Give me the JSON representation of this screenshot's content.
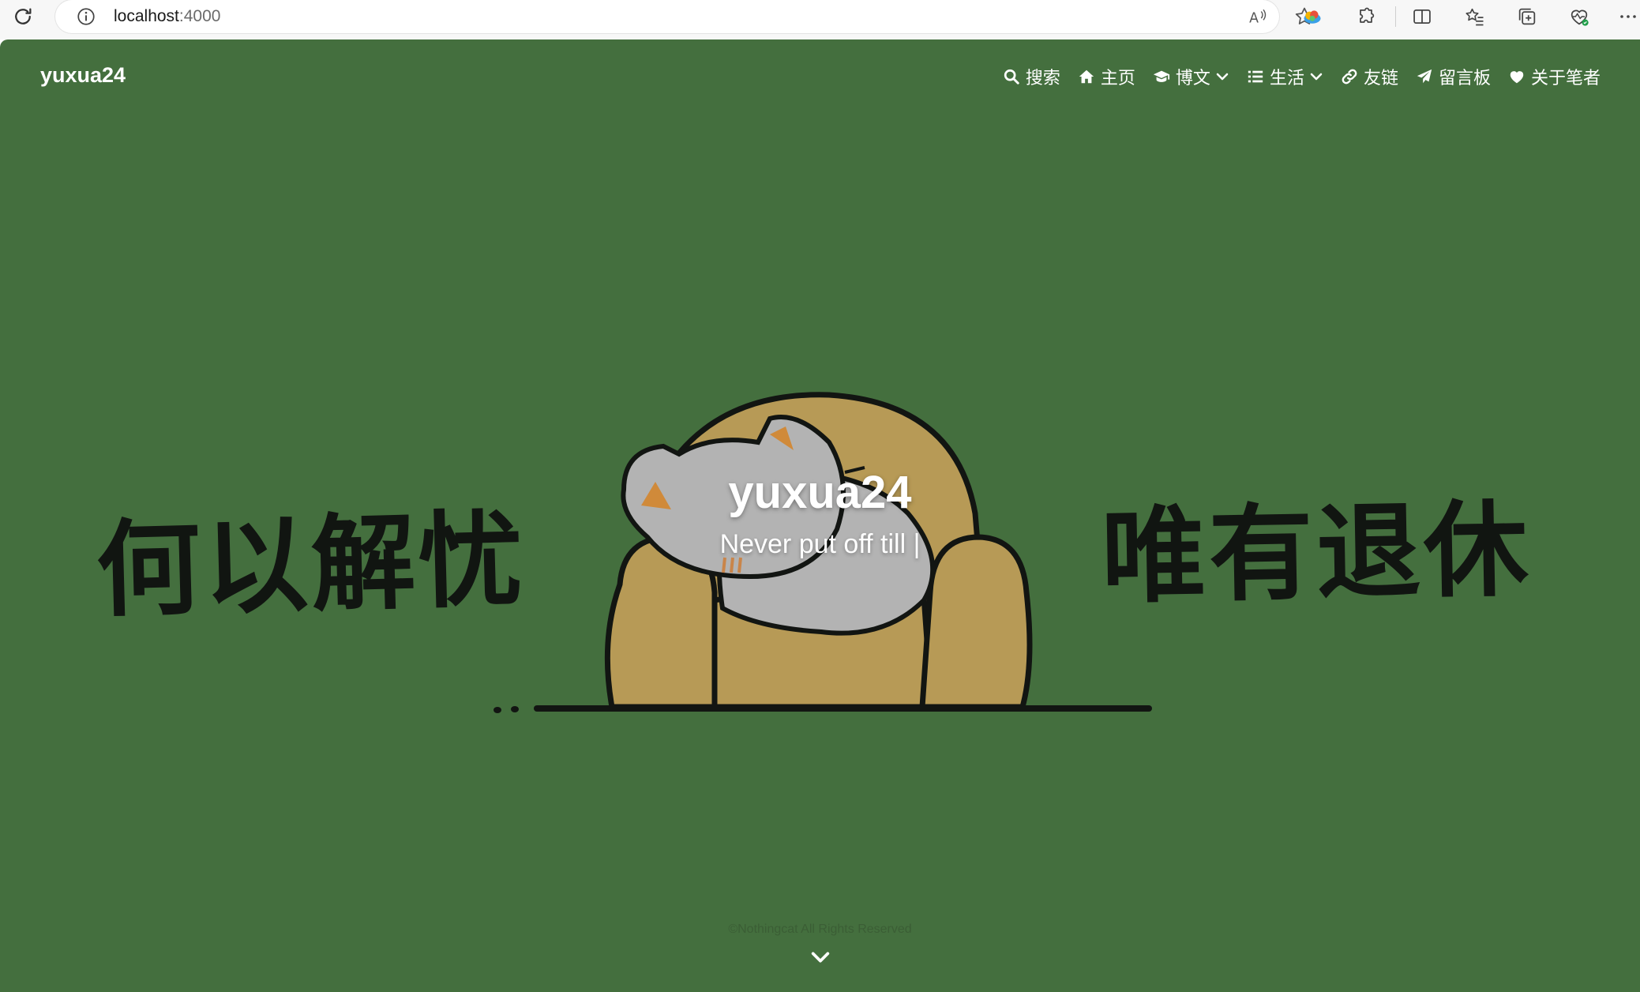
{
  "browser": {
    "url_host": "localhost",
    "url_port": ":4000"
  },
  "site": {
    "brand": "yuxua24",
    "title": "yuxua24",
    "subtitle": "Never put off till |",
    "copyright": "©Nothingcat All Rights Reserved"
  },
  "nav": {
    "items": [
      {
        "label": "搜索",
        "icon": "search-icon"
      },
      {
        "label": "主页",
        "icon": "home-icon"
      },
      {
        "label": "博文",
        "icon": "graduation-cap-icon",
        "dropdown": true
      },
      {
        "label": "生活",
        "icon": "list-icon",
        "dropdown": true
      },
      {
        "label": "友链",
        "icon": "link-icon"
      },
      {
        "label": "留言板",
        "icon": "paper-plane-icon"
      },
      {
        "label": "关于笔者",
        "icon": "heart-icon"
      }
    ]
  },
  "hero": {
    "left_text": "何以解忧",
    "right_text": "唯有退休",
    "background_color": "#446f3e"
  }
}
